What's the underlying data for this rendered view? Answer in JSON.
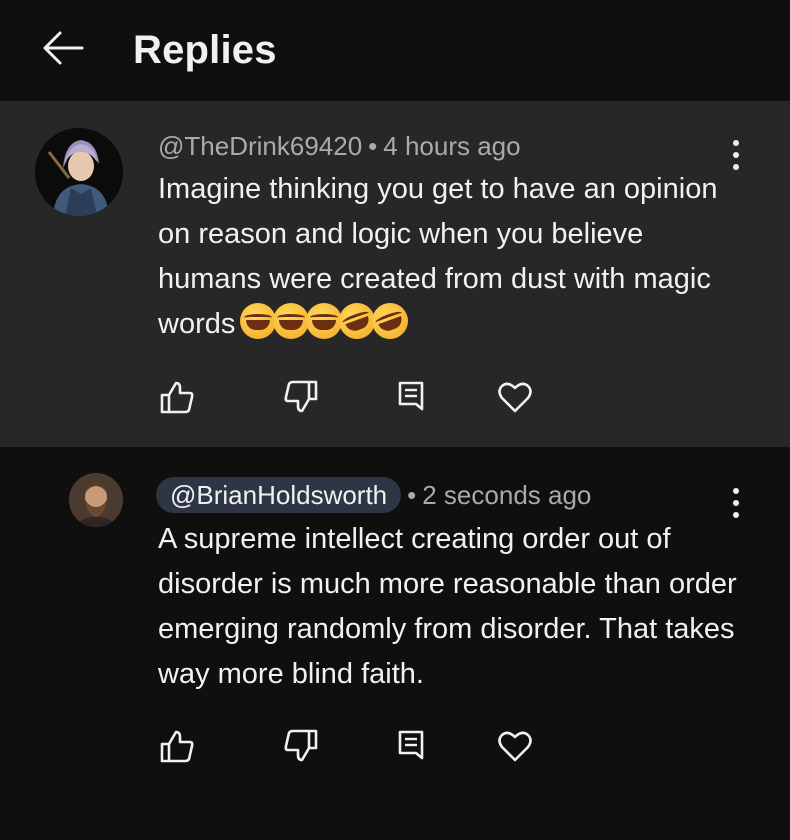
{
  "header": {
    "title": "Replies",
    "back_icon": "arrow-left-icon"
  },
  "comments": [
    {
      "author": "@TheDrink69420",
      "time": "4 hours ago",
      "text": "Imagine thinking you get to have an opinion on reason and logic when you believe humans were created from dust with magic words",
      "emojis": [
        "😂",
        "😂",
        "😂",
        "🤣",
        "🤣"
      ],
      "avatar": "anime-character-avatar"
    },
    {
      "author": "@BrianHoldsworth",
      "time": "2 seconds ago",
      "text": "A supreme intellect creating order out of disorder is much more reasonable than order emerging randomly from disorder. That takes way more blind faith.",
      "avatar": "bearded-man-avatar"
    }
  ],
  "separator": "•",
  "colors": {
    "background": "#0f0f0f",
    "highlight": "#272727",
    "text": "#f1f1f1",
    "secondary": "#aaaaaa",
    "chip": "#2e3645"
  }
}
